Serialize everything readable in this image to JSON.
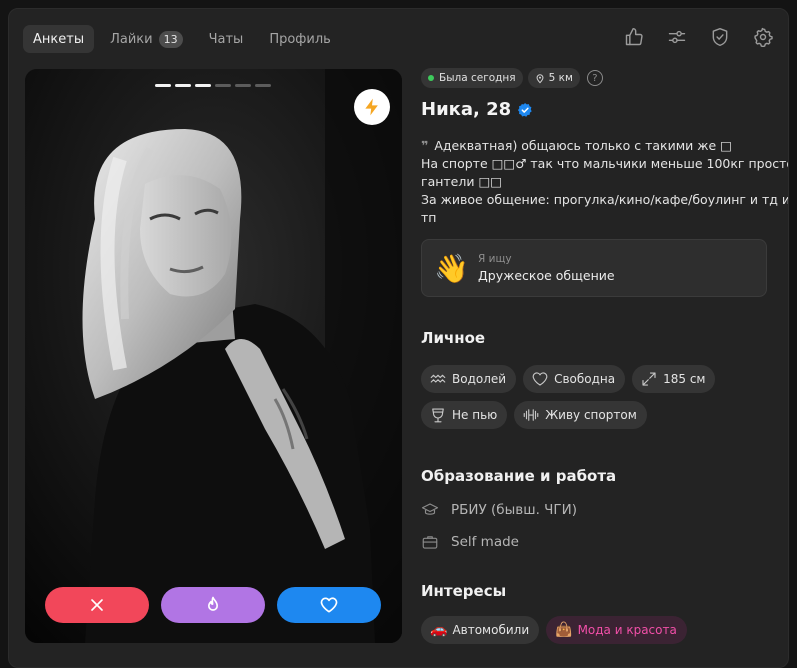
{
  "nav": {
    "tabs": [
      {
        "label": "Анкеты",
        "active": true
      },
      {
        "label": "Лайки",
        "badge": "13"
      },
      {
        "label": "Чаты"
      },
      {
        "label": "Профиль"
      }
    ],
    "icons": [
      "thumbs-up-icon",
      "sliders-icon",
      "shield-check-icon",
      "gear-icon"
    ]
  },
  "photo": {
    "photo_count": 6,
    "current_photo": 3,
    "boost_icon": "lightning-icon",
    "actions": [
      "close-icon",
      "flame-icon",
      "heart-icon"
    ]
  },
  "status": {
    "online": "Была сегодня",
    "distance": "5 км",
    "help": "?"
  },
  "profile": {
    "name": "Ника, 28",
    "verified": true
  },
  "bio": {
    "lines": [
      "Адекватная) общаюсь только с такими же □",
      "На спорте □□♂ так что мальчики меньше 100кг просто",
      "гантели □□",
      "За живое общение: прогулка/кино/кафе/боулинг и тд и",
      "тп"
    ]
  },
  "looking_for": {
    "emoji": "👋",
    "label": "Я ищу",
    "value": "Дружеское общение"
  },
  "personal": {
    "title": "Личное",
    "items": [
      {
        "icon": "aquarius-icon",
        "label": "Водолей"
      },
      {
        "icon": "heart-outline-icon",
        "label": "Свободна"
      },
      {
        "icon": "expand-arrows-icon",
        "label": "185 см"
      },
      {
        "icon": "glass-icon",
        "label": "Не пью"
      },
      {
        "icon": "dumbbell-icon",
        "label": "Живу спортом"
      }
    ]
  },
  "education": {
    "title": "Образование и работа",
    "items": [
      {
        "icon": "graduation-cap-icon",
        "label": "РБИУ (бывш. ЧГИ)"
      },
      {
        "icon": "briefcase-icon",
        "label": "Self made"
      }
    ]
  },
  "interests": {
    "title": "Интересы",
    "items": [
      {
        "emoji": "🚗",
        "label": "Автомобили",
        "highlight": false
      },
      {
        "emoji": "👜",
        "label": "Мода и красота",
        "highlight": true
      }
    ]
  },
  "colors": {
    "background": "#232323",
    "chip": "#353535",
    "dislike": "#f2475a",
    "superlike": "#b175e4",
    "like": "#1e88f0",
    "online": "#3ecb5c",
    "verified": "#1e88f0",
    "interest_highlight": "#f14fa8"
  }
}
